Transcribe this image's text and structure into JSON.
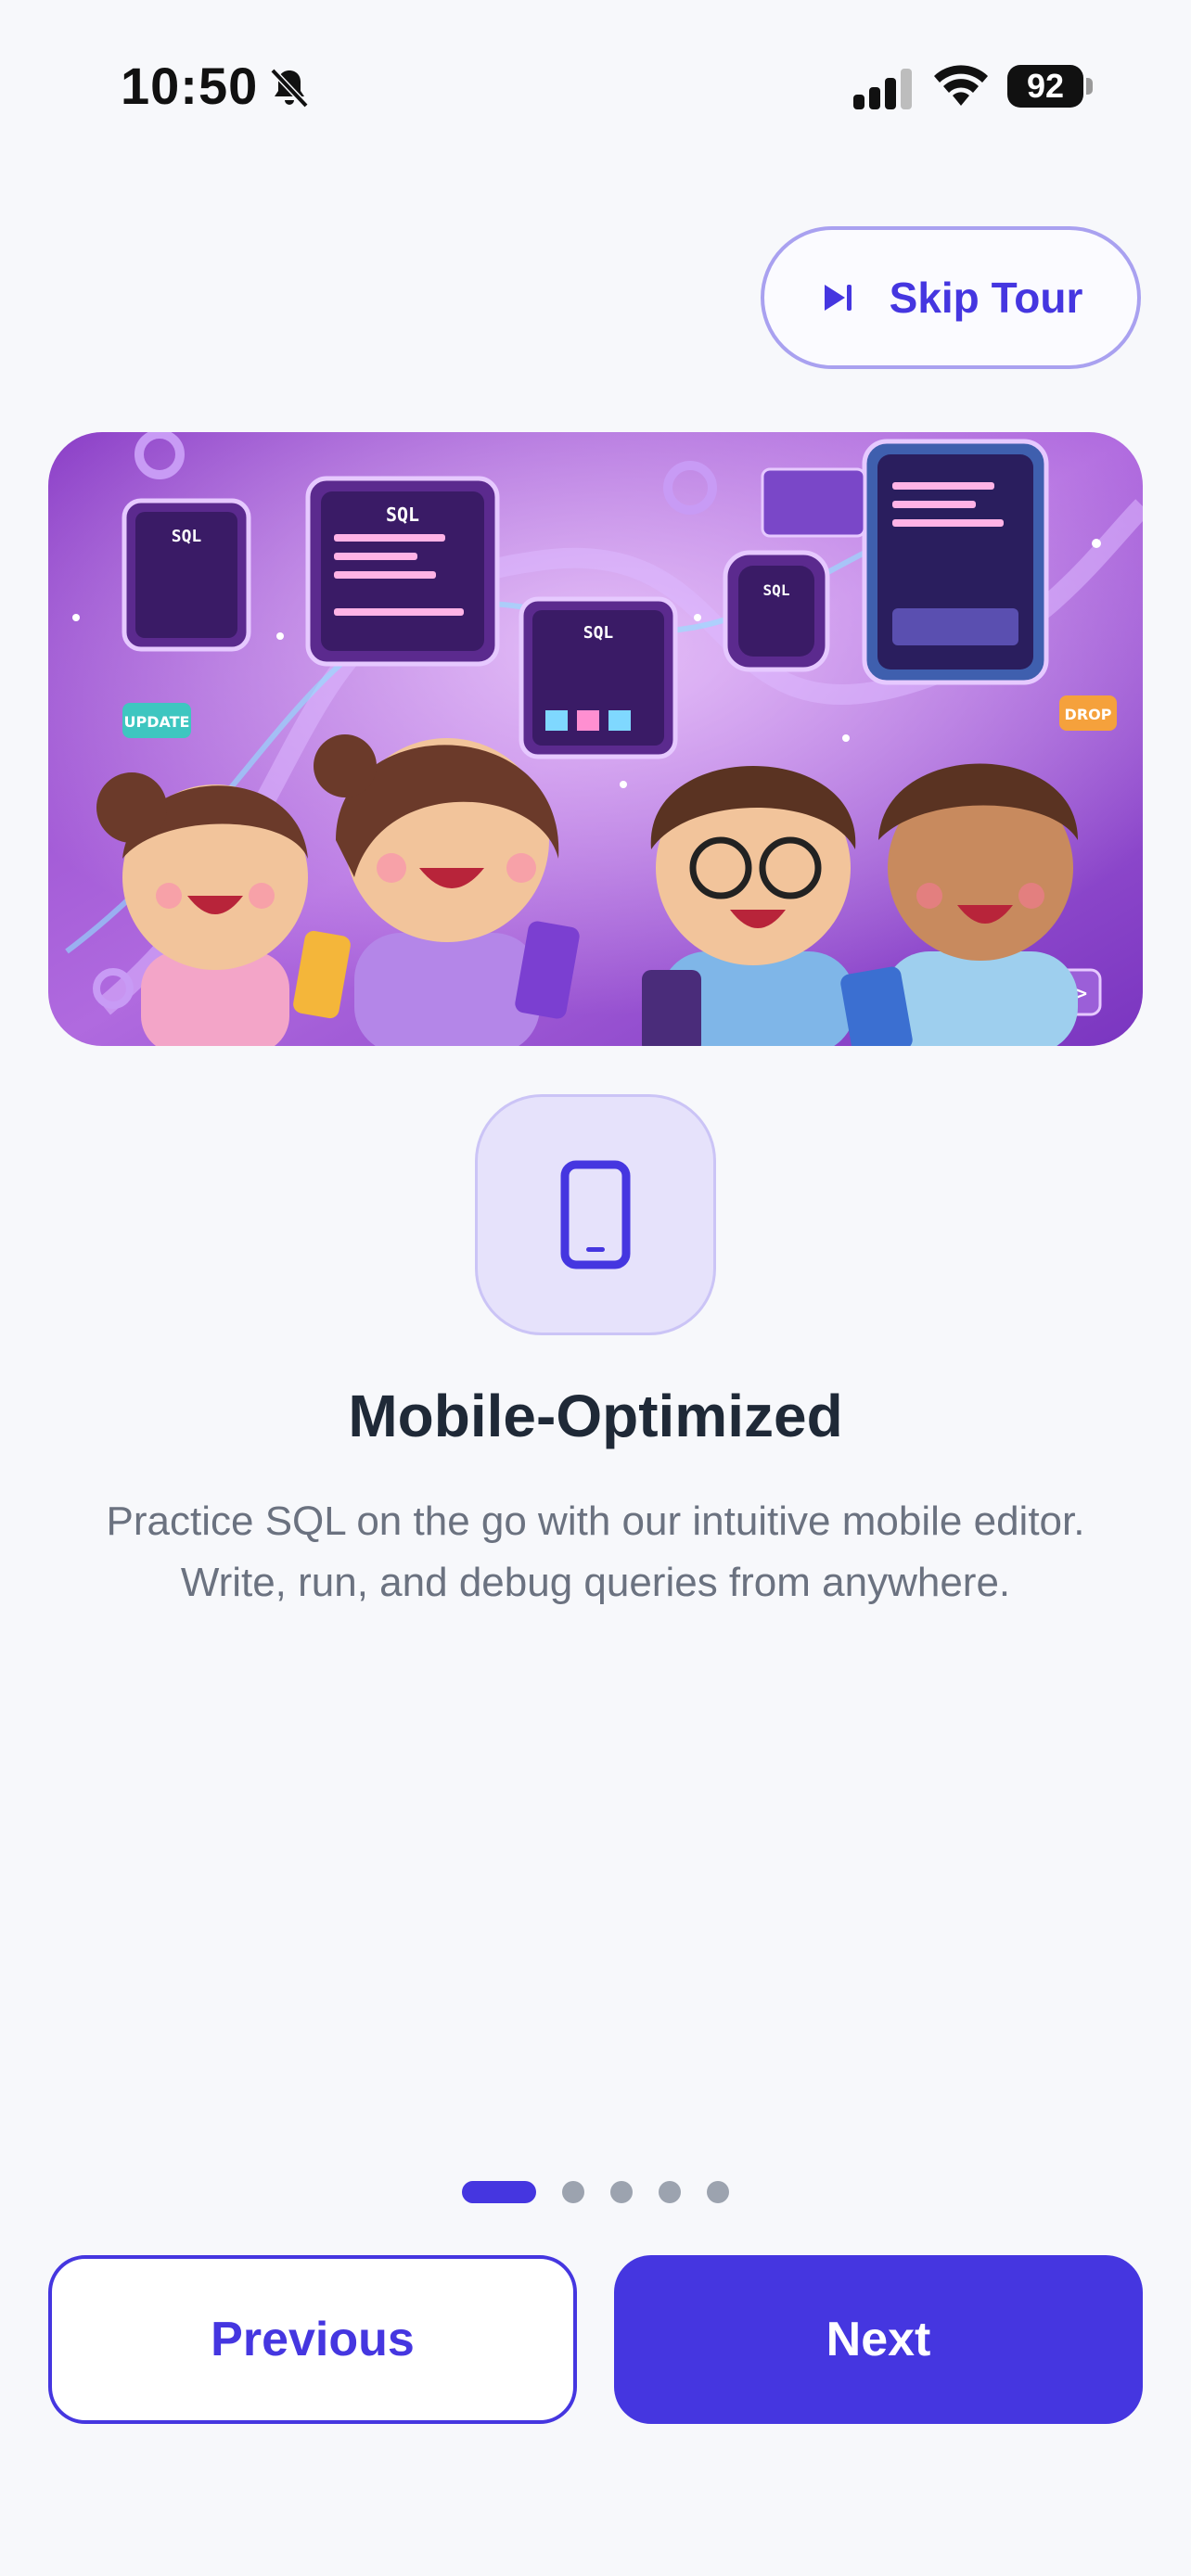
{
  "status_bar": {
    "time": "10:50",
    "battery": "92",
    "icons": [
      "bell-slash-icon",
      "cellular-signal-icon",
      "wifi-icon",
      "battery-icon"
    ]
  },
  "skip_tour": {
    "label": "Skip Tour",
    "icon": "skip-forward-icon"
  },
  "hero": {
    "icon": "illustration-kids-with-phones-sql",
    "labels": {
      "sql": "SQL",
      "update": "UPDATE",
      "drop": "DROP",
      "code": "</>"
    }
  },
  "feature": {
    "icon": "smartphone-icon",
    "title": "Mobile-Optimized",
    "description": "Practice SQL on the go with our intuitive mobile editor. Write, run, and debug queries from anywhere."
  },
  "pagination": {
    "current": 1,
    "total": 5
  },
  "navigation": {
    "previous_label": "Previous",
    "next_label": "Next"
  },
  "colors": {
    "accent": "#4536e0",
    "background": "#f7f8fb",
    "title": "#1f2937",
    "body_text": "#6b7280",
    "icon_box": "#e6e2fb"
  }
}
